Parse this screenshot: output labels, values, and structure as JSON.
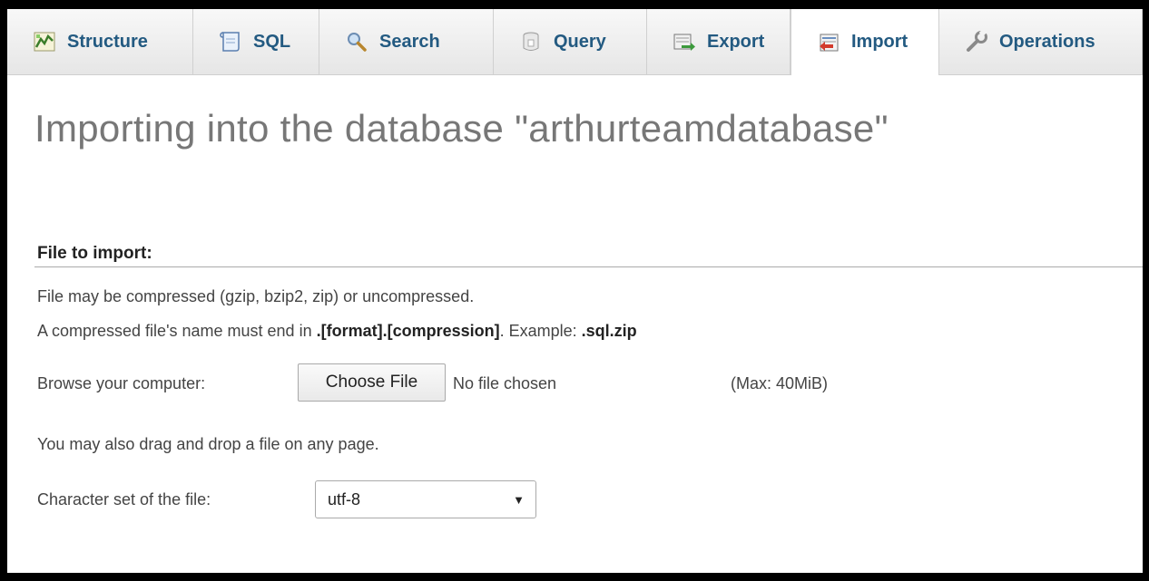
{
  "tabs": [
    {
      "label": "Structure",
      "icon": "structure-icon"
    },
    {
      "label": "SQL",
      "icon": "sql-icon"
    },
    {
      "label": "Search",
      "icon": "search-icon"
    },
    {
      "label": "Query",
      "icon": "query-icon"
    },
    {
      "label": "Export",
      "icon": "export-icon"
    },
    {
      "label": "Import",
      "icon": "import-icon",
      "active": true
    },
    {
      "label": "Operations",
      "icon": "operations-icon"
    }
  ],
  "page": {
    "title": "Importing into the database \"arthurteamdatabase\""
  },
  "file_section": {
    "header": "File to import:",
    "compression_note": "File may be compressed (gzip, bzip2, zip) or uncompressed.",
    "name_note_prefix": "A compressed file's name must end in ",
    "name_note_format": ".[format].[compression]",
    "name_note_middle": ". Example: ",
    "name_note_example": ".sql.zip",
    "browse_label": "Browse your computer:",
    "choose_file_button": "Choose File",
    "no_file_text": "No file chosen",
    "max_size": "(Max: 40MiB)",
    "drag_drop_note": "You may also drag and drop a file on any page.",
    "charset_label": "Character set of the file:",
    "charset_value": "utf-8"
  },
  "colors": {
    "tab_text": "#235a81",
    "title": "#777777"
  }
}
